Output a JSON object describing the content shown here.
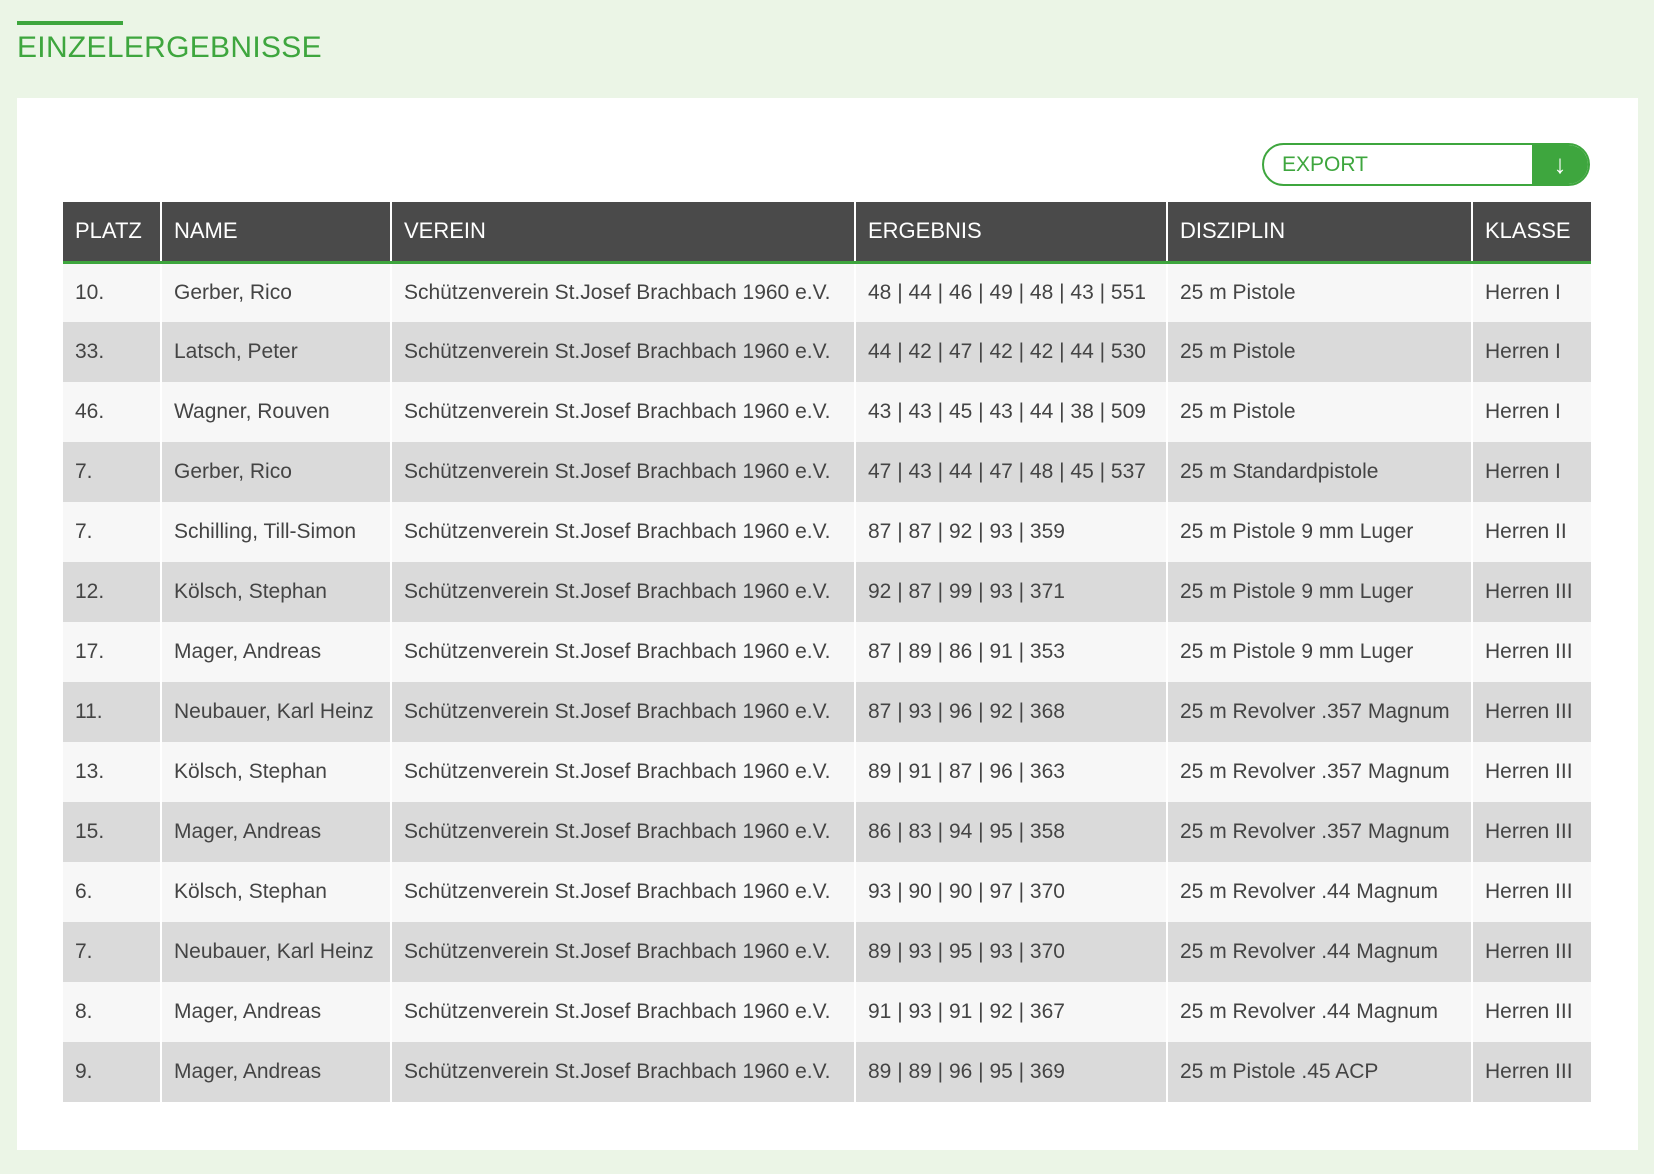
{
  "page": {
    "title": "EINZELERGEBNISSE"
  },
  "toolbar": {
    "export_label": "EXPORT",
    "export_icon": "↓"
  },
  "colors": {
    "accent": "#3ea63e",
    "header_bg": "#4a4a4a",
    "page_bg": "#ebf5e6"
  },
  "table": {
    "columns": [
      "PLATZ",
      "NAME",
      "VEREIN",
      "ERGEBNIS",
      "DISZIPLIN",
      "KLASSE"
    ],
    "rows": [
      [
        "10.",
        "Gerber, Rico",
        "Schützenverein St.Josef Brachbach 1960 e.V.",
        "48 | 44 | 46 | 49 | 48 | 43 | 551",
        "25 m Pistole",
        "Herren I"
      ],
      [
        "33.",
        "Latsch, Peter",
        "Schützenverein St.Josef Brachbach 1960 e.V.",
        "44 | 42 | 47 | 42 | 42 | 44 | 530",
        "25 m Pistole",
        "Herren I"
      ],
      [
        "46.",
        "Wagner, Rouven",
        "Schützenverein St.Josef Brachbach 1960 e.V.",
        "43 | 43 | 45 | 43 | 44 | 38 | 509",
        "25 m Pistole",
        "Herren I"
      ],
      [
        "7.",
        "Gerber, Rico",
        "Schützenverein St.Josef Brachbach 1960 e.V.",
        "47 | 43 | 44 | 47 | 48 | 45 | 537",
        "25 m Standardpistole",
        "Herren I"
      ],
      [
        "7.",
        "Schilling, Till-Simon",
        "Schützenverein St.Josef Brachbach 1960 e.V.",
        "87 | 87 | 92 | 93 | 359",
        "25 m Pistole 9 mm Luger",
        "Herren II"
      ],
      [
        "12.",
        "Kölsch, Stephan",
        "Schützenverein St.Josef Brachbach 1960 e.V.",
        "92 | 87 | 99 | 93 | 371",
        "25 m Pistole 9 mm Luger",
        "Herren III"
      ],
      [
        "17.",
        "Mager, Andreas",
        "Schützenverein St.Josef Brachbach 1960 e.V.",
        "87 | 89 | 86 | 91 | 353",
        "25 m Pistole 9 mm Luger",
        "Herren III"
      ],
      [
        "11.",
        "Neubauer, Karl Heinz",
        "Schützenverein St.Josef Brachbach 1960 e.V.",
        "87 | 93 | 96 | 92 | 368",
        "25 m Revolver .357 Magnum",
        "Herren III"
      ],
      [
        "13.",
        "Kölsch, Stephan",
        "Schützenverein St.Josef Brachbach 1960 e.V.",
        "89 | 91 | 87 | 96 | 363",
        "25 m Revolver .357 Magnum",
        "Herren III"
      ],
      [
        "15.",
        "Mager, Andreas",
        "Schützenverein St.Josef Brachbach 1960 e.V.",
        "86 | 83 | 94 | 95 | 358",
        "25 m Revolver .357 Magnum",
        "Herren III"
      ],
      [
        "6.",
        "Kölsch, Stephan",
        "Schützenverein St.Josef Brachbach 1960 e.V.",
        "93 | 90 | 90 | 97 | 370",
        "25 m Revolver .44 Magnum",
        "Herren III"
      ],
      [
        "7.",
        "Neubauer, Karl Heinz",
        "Schützenverein St.Josef Brachbach 1960 e.V.",
        "89 | 93 | 95 | 93 | 370",
        "25 m Revolver .44 Magnum",
        "Herren III"
      ],
      [
        "8.",
        "Mager, Andreas",
        "Schützenverein St.Josef Brachbach 1960 e.V.",
        "91 | 93 | 91 | 92 | 367",
        "25 m Revolver .44 Magnum",
        "Herren III"
      ],
      [
        "9.",
        "Mager, Andreas",
        "Schützenverein St.Josef Brachbach 1960 e.V.",
        "89 | 89 | 96 | 95 | 369",
        "25 m Pistole .45 ACP",
        "Herren III"
      ]
    ]
  }
}
